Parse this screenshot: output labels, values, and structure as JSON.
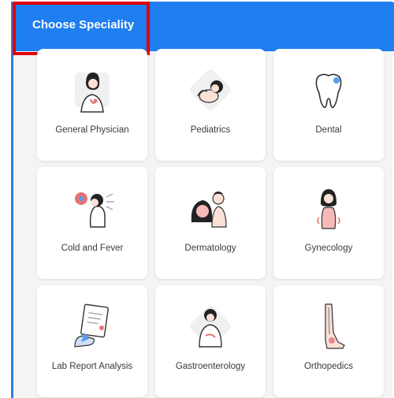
{
  "header": {
    "title": "Choose Speciality"
  },
  "colors": {
    "header_bg": "#1f7ef0",
    "highlight": "#e10000",
    "accent_pink": "#f2a6a6"
  },
  "specialities": [
    {
      "label": "General Physician",
      "icon": "doctor-icon"
    },
    {
      "label": "Pediatrics",
      "icon": "baby-icon"
    },
    {
      "label": "Dental",
      "icon": "tooth-icon"
    },
    {
      "label": "Cold and Fever",
      "icon": "sneeze-icon"
    },
    {
      "label": "Dermatology",
      "icon": "skin-care-icon"
    },
    {
      "label": "Gynecology",
      "icon": "female-body-icon"
    },
    {
      "label": "Lab Report Analysis",
      "icon": "lab-report-icon"
    },
    {
      "label": "Gastroenterology",
      "icon": "stomach-icon"
    },
    {
      "label": "Orthopedics",
      "icon": "leg-bone-icon"
    }
  ]
}
